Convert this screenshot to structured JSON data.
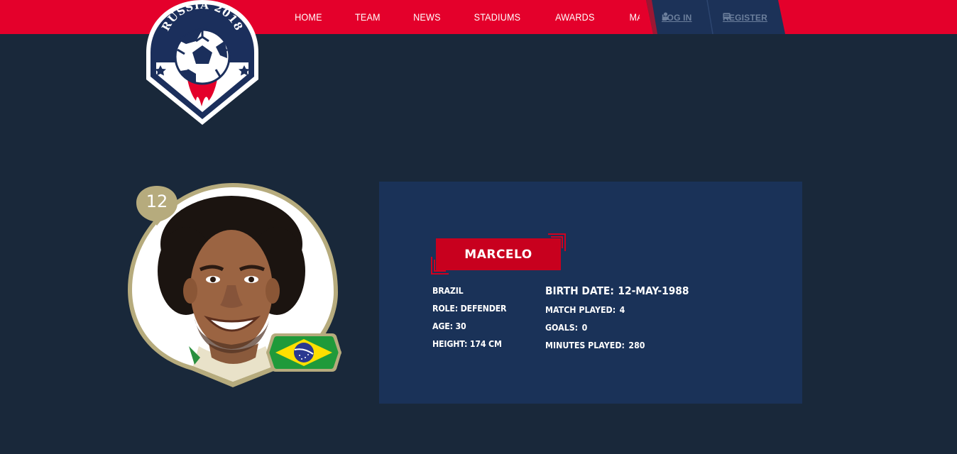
{
  "header": {
    "nav": [
      "HOME",
      "TEAM",
      "NEWS",
      "STADIUMS",
      "AWARDS",
      "MATCHES"
    ],
    "login_label": "LOG IN",
    "register_label": "REGISTER",
    "login_icon": "user-icon",
    "register_icon": "id-card-icon"
  },
  "logo": {
    "text": "RUSSIA 2018",
    "icon": "soccer-ball-icon"
  },
  "player": {
    "number": "12",
    "name": "MARCELO",
    "country": "BRAZIL",
    "role": "ROLE: DEFENDER",
    "age": "AGE: 30",
    "height": "HEIGHT: 174 CM",
    "birth_label": "BIRTH DATE:",
    "birth_value": "12-MAY-1988",
    "matches_label": "MATCH PLAYED:",
    "matches_value": "4",
    "goals_label": "GOALS:",
    "goals_value": "0",
    "minutes_label": "MINUTES PLAYED:",
    "minutes_value": "280",
    "flag_icon": "brazil-flag-icon"
  },
  "colors": {
    "header_red": "#e4002b",
    "page_bg": "#19283a",
    "card_bg": "#1a3258",
    "name_red": "#c8001e",
    "gold": "#b6ab7d",
    "auth_navy": "#1c3258"
  }
}
